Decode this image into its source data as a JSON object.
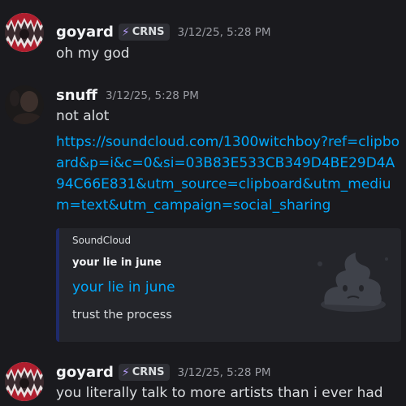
{
  "messages": [
    {
      "username": "goyard",
      "tag": "CRNS",
      "tag_icon": "bolt-icon",
      "timestamp": "3/12/25, 5:28 PM",
      "text": "oh my god"
    },
    {
      "username": "snuff",
      "timestamp": "3/12/25, 5:28 PM",
      "text": "not alot",
      "link": "https://soundcloud.com/1300witchboy?ref=clipboard&p=i&c=0&si=03B83E533CB349D4BE29D4A94C66E831&utm_source=clipboard&utm_medium=text&utm_campaign=social_sharing",
      "embed": {
        "provider": "SoundCloud",
        "author": "your lie in june",
        "title": "your lie in june",
        "description": "trust the process",
        "thumbnail_icon": "poop-icon",
        "accent_color": "#1e2a6b"
      }
    },
    {
      "username": "goyard",
      "tag": "CRNS",
      "tag_icon": "bolt-icon",
      "timestamp": "3/12/25, 5:28 PM",
      "text": "you literally talk to more artists than i ever had"
    }
  ],
  "colors": {
    "background": "#1a1a1e",
    "link": "#00a8fc",
    "tag_bg": "#2e2f35",
    "bolt": "#b39af5"
  }
}
